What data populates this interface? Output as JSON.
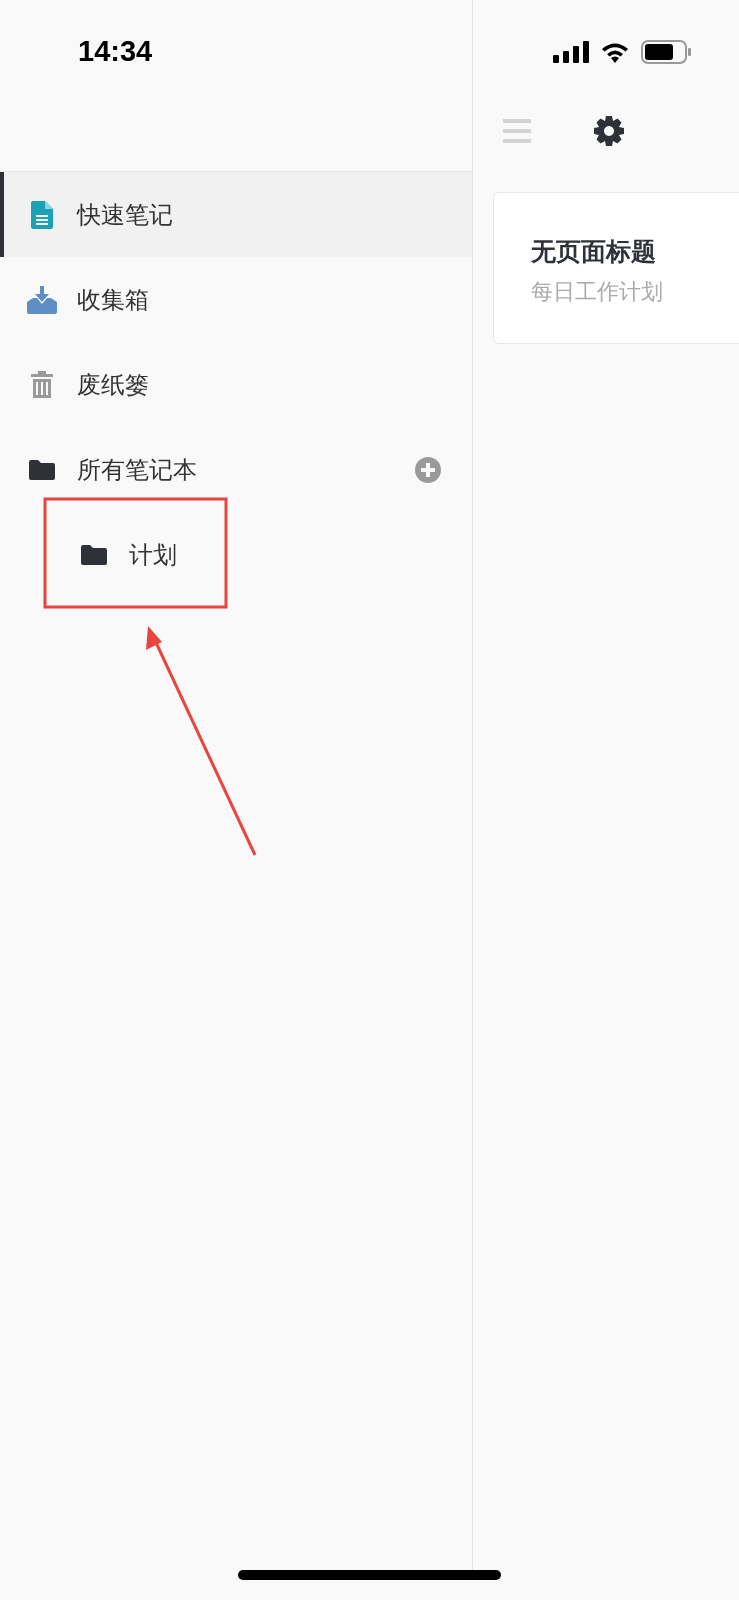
{
  "status_bar": {
    "time": "14:34"
  },
  "sidebar": {
    "items": [
      {
        "kind": "note",
        "label": "快速笔记",
        "selected": true
      },
      {
        "kind": "inbox",
        "label": "收集箱",
        "selected": false
      },
      {
        "kind": "trash",
        "label": "废纸篓",
        "selected": false
      },
      {
        "kind": "folder",
        "label": "所有笔记本",
        "selected": false,
        "children": [
          {
            "kind": "folder",
            "label": "计划",
            "selected": false
          }
        ]
      }
    ]
  },
  "notes": [
    {
      "title": "无页面标题",
      "preview": "每日工作计划"
    }
  ],
  "annotation": {
    "kind": "highlight-arrow"
  }
}
